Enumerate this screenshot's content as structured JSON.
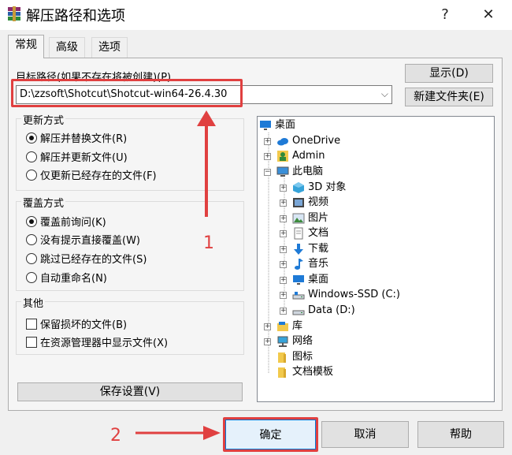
{
  "window": {
    "title": "解压路径和选项",
    "help_glyph": "?",
    "close_glyph": "✕"
  },
  "tabs": [
    {
      "label": "常规",
      "active": true
    },
    {
      "label": "高级",
      "active": false
    },
    {
      "label": "选项",
      "active": false
    }
  ],
  "destination": {
    "label": "目标路径(如果不存在将被创建)(P)",
    "value": "D:\\zzsoft\\Shotcut\\Shotcut-win64-26.4.30",
    "show_button": "显示(D)",
    "new_folder_button": "新建文件夹(E)"
  },
  "update_mode": {
    "title": "更新方式",
    "options": [
      {
        "label": "解压并替换文件(R)",
        "selected": true
      },
      {
        "label": "解压并更新文件(U)",
        "selected": false
      },
      {
        "label": "仅更新已经存在的文件(F)",
        "selected": false
      }
    ]
  },
  "overwrite_mode": {
    "title": "覆盖方式",
    "options": [
      {
        "label": "覆盖前询问(K)",
        "selected": true
      },
      {
        "label": "没有提示直接覆盖(W)",
        "selected": false
      },
      {
        "label": "跳过已经存在的文件(S)",
        "selected": false
      },
      {
        "label": "自动重命名(N)",
        "selected": false
      }
    ]
  },
  "misc": {
    "title": "其他",
    "options": [
      {
        "label": "保留损坏的文件(B)",
        "checked": false
      },
      {
        "label": "在资源管理器中显示文件(X)",
        "checked": false
      }
    ]
  },
  "save_settings_button": "保存设置(V)",
  "tree": {
    "items": [
      {
        "label": "桌面",
        "icon": "desktop-icon"
      },
      {
        "label": "OneDrive",
        "icon": "cloud-icon"
      },
      {
        "label": "Admin",
        "icon": "user-icon"
      },
      {
        "label": "此电脑",
        "icon": "computer-icon"
      },
      {
        "label": "3D 对象",
        "icon": "3d-objects-icon"
      },
      {
        "label": "视频",
        "icon": "video-icon"
      },
      {
        "label": "图片",
        "icon": "pictures-icon"
      },
      {
        "label": "文档",
        "icon": "documents-icon"
      },
      {
        "label": "下载",
        "icon": "download-icon"
      },
      {
        "label": "音乐",
        "icon": "music-icon"
      },
      {
        "label": "桌面",
        "icon": "desktop-icon"
      },
      {
        "label": "Windows-SSD (C:)",
        "icon": "drive-icon"
      },
      {
        "label": "Data (D:)",
        "icon": "drive-icon"
      },
      {
        "label": "库",
        "icon": "library-icon"
      },
      {
        "label": "网络",
        "icon": "network-icon"
      },
      {
        "label": "图标",
        "icon": "folder-icon"
      },
      {
        "label": "文档模板",
        "icon": "folder-icon"
      }
    ]
  },
  "footer": {
    "ok": "确定",
    "cancel": "取消",
    "help": "帮助"
  },
  "annotations": {
    "marker_1": "1",
    "marker_2": "2"
  },
  "colors": {
    "annotation_red": "#e04040",
    "folder_yellow": "#f2c94c",
    "win_blue": "#1e7ad6"
  }
}
